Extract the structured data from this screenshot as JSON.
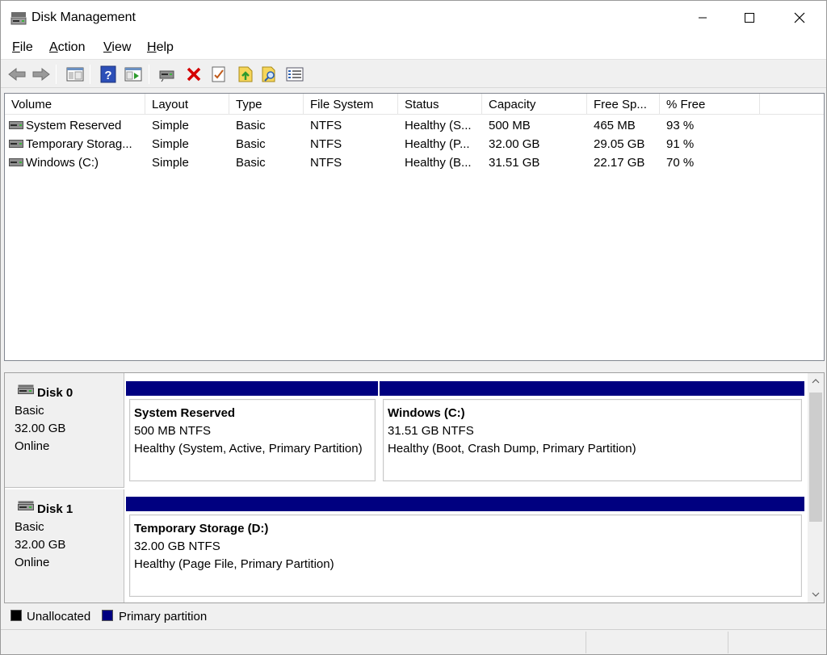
{
  "window": {
    "title": "Disk Management"
  },
  "menu": [
    {
      "label": "File",
      "accel": "F",
      "rest": "ile"
    },
    {
      "label": "Action",
      "accel": "A",
      "rest": "ction"
    },
    {
      "label": "View",
      "accel": "V",
      "rest": "iew"
    },
    {
      "label": "Help",
      "accel": "H",
      "rest": "elp"
    }
  ],
  "toolbar": {
    "icons": [
      "back-arrow-icon",
      "forward-arrow-icon",
      "show-hide-console-tree-icon",
      "help-icon",
      "show-hide-action-pane-icon",
      "connect-virtual-disk-icon",
      "delete-icon",
      "properties-icon",
      "export-list-icon",
      "find-icon",
      "settings-list-icon"
    ]
  },
  "volumes": {
    "headers": [
      "Volume",
      "Layout",
      "Type",
      "File System",
      "Status",
      "Capacity",
      "Free Sp...",
      "% Free"
    ],
    "rows": [
      [
        "System Reserved",
        "Simple",
        "Basic",
        "NTFS",
        "Healthy (S...",
        "500 MB",
        "465 MB",
        "93 %"
      ],
      [
        "Temporary Storag...",
        "Simple",
        "Basic",
        "NTFS",
        "Healthy (P...",
        "32.00 GB",
        "29.05 GB",
        "91 %"
      ],
      [
        "Windows (C:)",
        "Simple",
        "Basic",
        "NTFS",
        "Healthy (B...",
        "31.51 GB",
        "22.17 GB",
        "70 %"
      ]
    ]
  },
  "disks": [
    {
      "name": "Disk 0",
      "type": "Basic",
      "size": "32.00 GB",
      "state": "Online",
      "partitions": [
        {
          "name": "System Reserved",
          "size_fs": "500 MB NTFS",
          "status": "Healthy (System, Active, Primary Partition)"
        },
        {
          "name": "Windows  (C:)",
          "size_fs": "31.51 GB NTFS",
          "status": "Healthy (Boot, Crash Dump, Primary Partition)"
        }
      ]
    },
    {
      "name": "Disk 1",
      "type": "Basic",
      "size": "32.00 GB",
      "state": "Online",
      "partitions": [
        {
          "name": "Temporary Storage  (D:)",
          "size_fs": "32.00 GB NTFS",
          "status": "Healthy (Page File, Primary Partition)"
        }
      ]
    }
  ],
  "legend": [
    {
      "label": "Unallocated",
      "color": "#000000"
    },
    {
      "label": "Primary partition",
      "color": "#000080"
    }
  ],
  "colors": {
    "partition_bar": "#000080",
    "delete_red": "#d40000"
  }
}
